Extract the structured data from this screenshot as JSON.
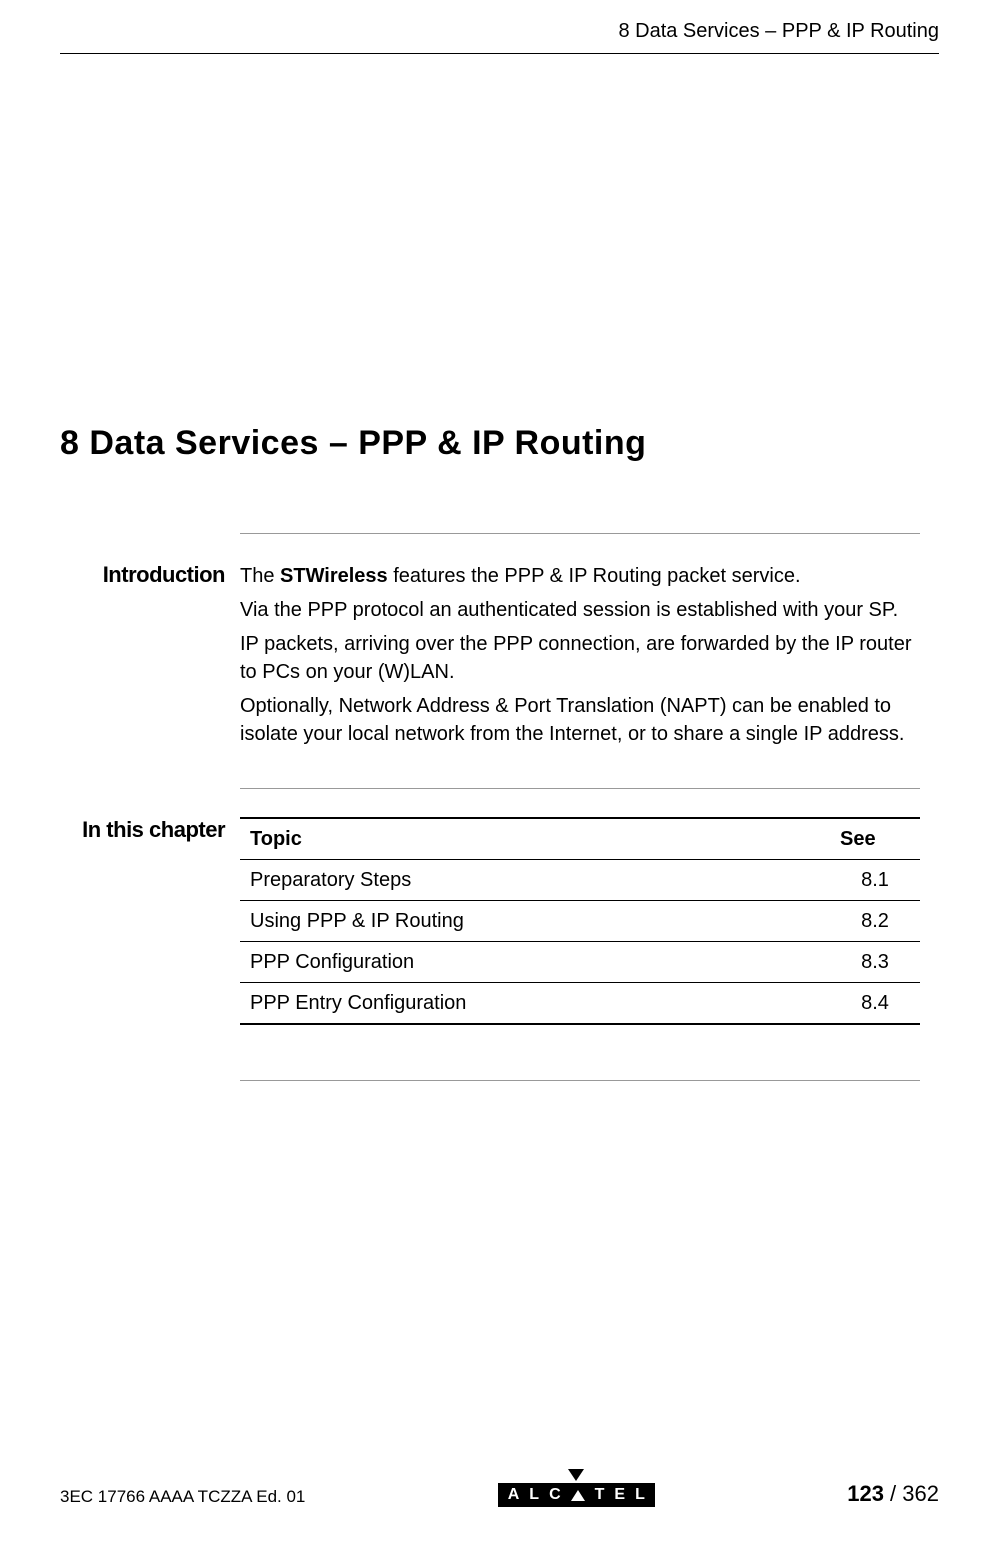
{
  "header": {
    "running_title": "8   Data Services – PPP & IP Routing"
  },
  "chapter": {
    "title": "8   Data Services – PPP & IP Routing"
  },
  "intro": {
    "label": "Introduction",
    "p1_pre": "The ",
    "p1_bold": "STWireless",
    "p1_post": " features the PPP & IP Routing packet service.",
    "p2": "Via the PPP protocol an authenticated session is established with your SP.",
    "p3": "IP packets, arriving over the PPP connection, are forwarded by the IP router to PCs on your (W)LAN.",
    "p4": "Optionally, Network Address & Port Translation (NAPT) can be enabled to isolate your local network from the Internet, or to share a single IP address."
  },
  "chapter_contents": {
    "label": "In this chapter",
    "table": {
      "col_topic": "Topic",
      "col_see": "See",
      "rows": [
        {
          "topic": "Preparatory Steps",
          "see": "8.1"
        },
        {
          "topic": "Using PPP & IP Routing",
          "see": "8.2"
        },
        {
          "topic": "PPP Configuration",
          "see": "8.3"
        },
        {
          "topic": "PPP Entry Configuration",
          "see": "8.4"
        }
      ]
    }
  },
  "footer": {
    "doc_ref": "3EC 17766 AAAA TCZZA Ed. 01",
    "logo_text_left": "ALC",
    "logo_text_right": "TEL",
    "page_current": "123",
    "page_separator": " / ",
    "page_total": "362"
  }
}
